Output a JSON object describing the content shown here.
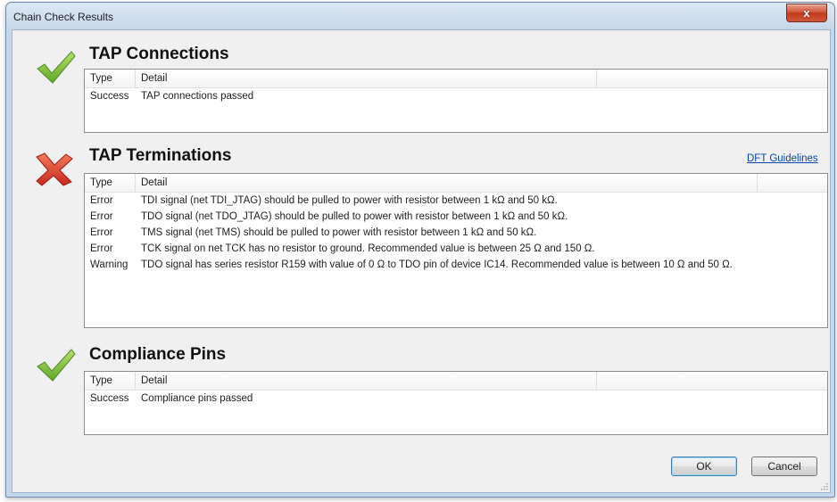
{
  "window": {
    "title": "Chain Check Results",
    "close_symbol": "x"
  },
  "sections": [
    {
      "title": "TAP Connections",
      "status": "success",
      "icon": "checkmark-icon",
      "columns": [
        "Type",
        "Detail"
      ],
      "rows": [
        {
          "type": "Success",
          "detail": "TAP connections passed"
        }
      ]
    },
    {
      "title": "TAP Terminations",
      "status": "error",
      "icon": "error-x-icon",
      "link": "DFT Guidelines",
      "columns": [
        "Type",
        "Detail"
      ],
      "rows": [
        {
          "type": "Error",
          "detail": "TDI signal (net TDI_JTAG) should be pulled to power with resistor between 1 kΩ and 50 kΩ."
        },
        {
          "type": "Error",
          "detail": "TDO signal (net TDO_JTAG) should be pulled to power with resistor between 1 kΩ and 50 kΩ."
        },
        {
          "type": "Error",
          "detail": "TMS signal (net TMS) should be pulled to power with resistor between 1 kΩ and 50 kΩ."
        },
        {
          "type": "Error",
          "detail": "TCK signal on net TCK has no resistor to ground. Recommended value is between 25 Ω and 150 Ω."
        },
        {
          "type": "Warning",
          "detail": "TDO signal has series resistor R159 with value of 0 Ω to TDO pin of device IC14. Recommended value is between 10 Ω and 50 Ω."
        }
      ]
    },
    {
      "title": "Compliance Pins",
      "status": "success",
      "icon": "checkmark-icon",
      "columns": [
        "Type",
        "Detail"
      ],
      "rows": [
        {
          "type": "Success",
          "detail": "Compliance pins passed"
        }
      ]
    }
  ],
  "buttons": {
    "ok": "OK",
    "cancel": "Cancel"
  },
  "colors": {
    "success": "#7dc242",
    "error": "#d9342b",
    "link": "#0645ad"
  }
}
